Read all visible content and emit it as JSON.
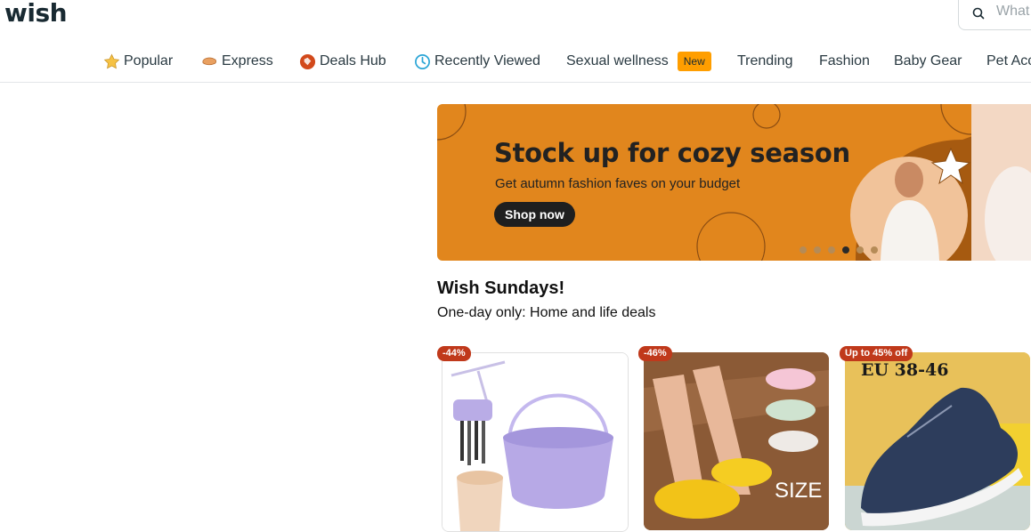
{
  "header": {
    "logo": "wish",
    "search_placeholder": "What"
  },
  "nav": {
    "items": [
      {
        "label": "Popular",
        "icon": "star-icon"
      },
      {
        "label": "Express",
        "icon": "express-icon"
      },
      {
        "label": "Deals Hub",
        "icon": "deals-tag-icon"
      },
      {
        "label": "Recently Viewed",
        "icon": "clock-icon"
      },
      {
        "label": "Sexual wellness",
        "badge": "New"
      },
      {
        "label": "Trending"
      },
      {
        "label": "Fashion"
      },
      {
        "label": "Baby Gear"
      },
      {
        "label": "Pet Acc"
      }
    ]
  },
  "banner": {
    "title": "Stock up for cozy season",
    "subtitle": "Get autumn fashion faves on your budget",
    "button": "Shop now",
    "slide_count": 6,
    "active_slide": 4
  },
  "section": {
    "title": "Wish Sundays!",
    "subtitle": "One-day only: Home and life deals"
  },
  "products": [
    {
      "discount": "-44%",
      "image": "makeup-brush-cleaner-bowl"
    },
    {
      "discount": "-46%",
      "image": "clog-slippers",
      "image_text": "SIZE"
    },
    {
      "discount": "Up to 45% off",
      "image": "mesh-sneaker",
      "image_text": "EU 38-46"
    }
  ],
  "colors": {
    "banner_bg": "#e1861d",
    "badge_new": "#ff9e00",
    "discount_badge": "#c0391b"
  }
}
